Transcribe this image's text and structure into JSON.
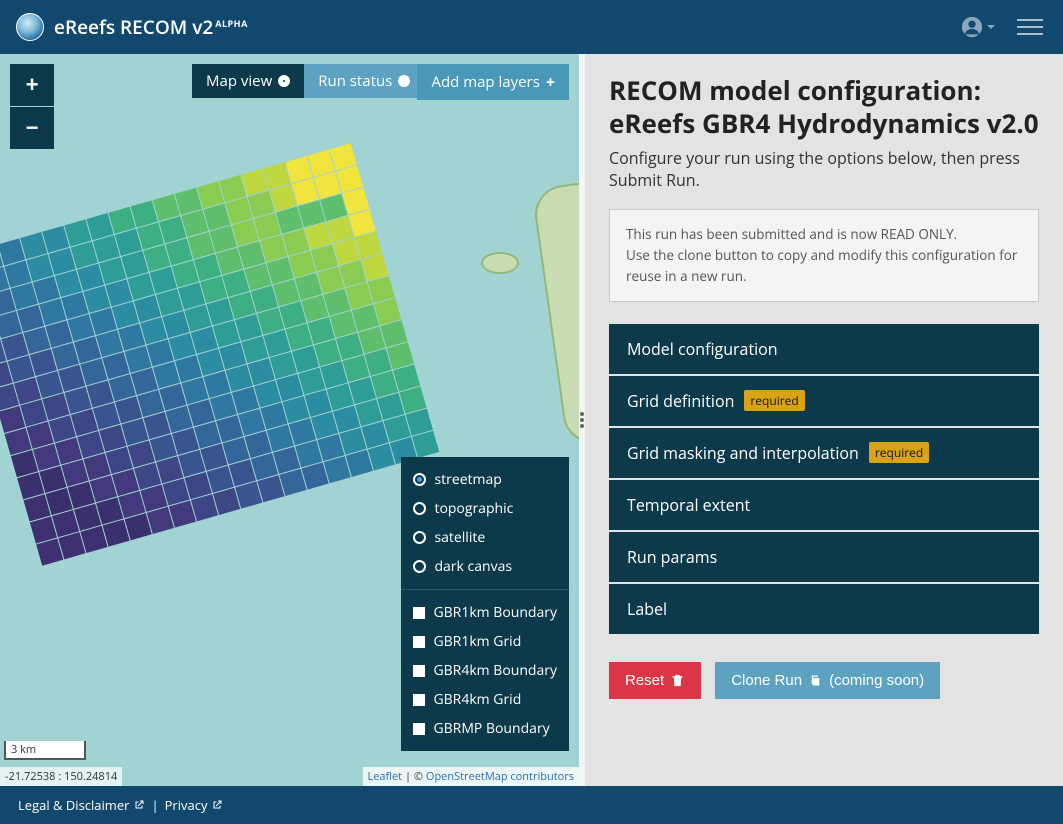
{
  "navbar": {
    "brand": "eReefs RECOM v2",
    "alpha": "ALPHA"
  },
  "map": {
    "tabs": {
      "map_view": "Map view",
      "run_status": "Run status",
      "add_layers": "Add map layers"
    },
    "basemaps": [
      "streetmap",
      "topographic",
      "satellite",
      "dark canvas"
    ],
    "basemap_selected": "streetmap",
    "overlays": [
      "GBR1km Boundary",
      "GBR1km Grid",
      "GBR4km Boundary",
      "GBR4km Grid",
      "GBRMP Boundary"
    ],
    "scale": "3 km",
    "coords": "-21.72538 : 150.24814",
    "attribution_leaflet": "Leaflet",
    "attribution_osm": "OpenStreetMap contributors"
  },
  "sidebar": {
    "title": "RECOM model configuration: eReefs GBR4 Hydrodynamics v2.0",
    "subtitle": "Configure your run using the options below, then press Submit Run.",
    "notice_line1": "This run has been submitted and is now READ ONLY.",
    "notice_line2": "Use the clone button to copy and modify this configuration for reuse in a new run.",
    "accordion": [
      {
        "label": "Model configuration",
        "required": false
      },
      {
        "label": "Grid definition",
        "required": true
      },
      {
        "label": "Grid masking and interpolation",
        "required": true
      },
      {
        "label": "Temporal extent",
        "required": false
      },
      {
        "label": "Run params",
        "required": false
      },
      {
        "label": "Label",
        "required": false
      }
    ],
    "required_badge": "required",
    "reset_label": "Reset",
    "clone_label": "Clone Run",
    "clone_suffix": "(coming soon)"
  },
  "footer": {
    "legal": "Legal & Disclaimer",
    "privacy": "Privacy",
    "sep": "|"
  }
}
